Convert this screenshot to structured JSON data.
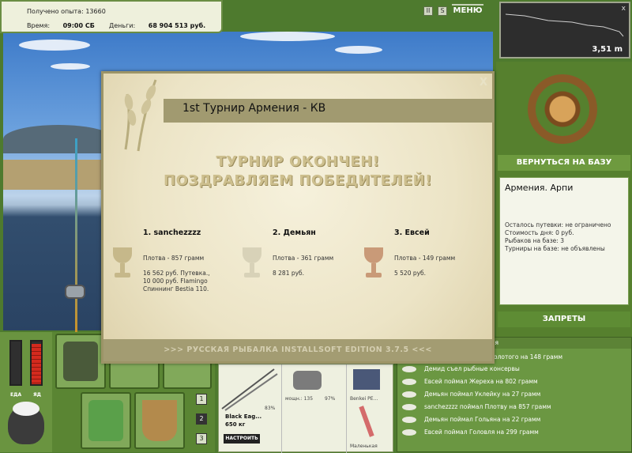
{
  "info": {
    "exp_label": "Получено опыта:",
    "exp_value": "13660",
    "time_label": "Время:",
    "time_value": "09:00 СБ",
    "money_label": "Деньги:",
    "money_value": "68 904 513 руб."
  },
  "top_controls": {
    "pause": "II",
    "sound": "S",
    "menu": "МЕНЮ"
  },
  "depth": {
    "value": "3,51 m",
    "close": "x"
  },
  "right_panel": {
    "back_button": "ВЕРНУТЬСЯ НА БАЗУ",
    "base_name": "Армения. Арпи",
    "lines": [
      "Осталось путевки: не ограничено",
      "Стоимость дня: 0 руб.",
      "Рыбаков на базе: 3",
      "Турниры на базе: не объявлены"
    ],
    "bans_button": "ЗАПРЕТЫ"
  },
  "gauges": {
    "food_label": "ЕДА",
    "poison_label": "ЯД",
    "food_level": 0.0,
    "poison_level": 0.95
  },
  "inventory": {
    "pages": [
      "1",
      "2",
      "3"
    ],
    "active_page": "2"
  },
  "tackle": {
    "rod_name": "Black Eag...",
    "rod_weight": "650 кг",
    "setup_button": "НАСТРОИТЬ",
    "line_pct": "83%",
    "reel_power": "мощн.: 135",
    "reel_pct": "97%",
    "bait_name": "Benkei PE...",
    "lure_name": "Маленькая"
  },
  "log": {
    "header": "ия",
    "first_line": "золотого на 148 грамм",
    "items": [
      "Демид съел рыбные консервы",
      "Евсей поймал Жереха на 802 грамм",
      "Демьян поймал Уклейку на 27 грамм",
      "sanchezzzz поймал Плотву на 857 грамм",
      "Демьян поймал Гольяна на 22 грамм",
      "Евсей поймал Головля на 299 грамм"
    ]
  },
  "dialog": {
    "title": "1st Турнир Армения - КВ",
    "close": "X",
    "headline1": "ТУРНИР ОКОНЧЕН!",
    "headline2": "ПОЗДРАВЛЯЕМ ПОБЕДИТЕЛЕЙ!",
    "footer": ">>> РУССКАЯ РЫБАЛКА INSTALLSOFT EDITION 3.7.5 <<<",
    "winners": [
      {
        "place": "1. sanchezzzz",
        "catch": "Плотва - 857 грамм",
        "prize1": "16 562 руб. Путевка.,",
        "prize2": "10 000 руб. Flamingo",
        "prize3": "Спиннинг Bestia 110.",
        "cup_color": "#c6b88a"
      },
      {
        "place": "2. Демьян",
        "catch": "Плотва - 361 грамм",
        "prize1": "8 281 руб.",
        "prize2": "",
        "prize3": "",
        "cup_color": "#d8d2b8"
      },
      {
        "place": "3. Евсей",
        "catch": "Плотва - 149 грамм",
        "prize1": "5 520 руб.",
        "prize2": "",
        "prize3": "",
        "cup_color": "#c99a78"
      }
    ]
  }
}
